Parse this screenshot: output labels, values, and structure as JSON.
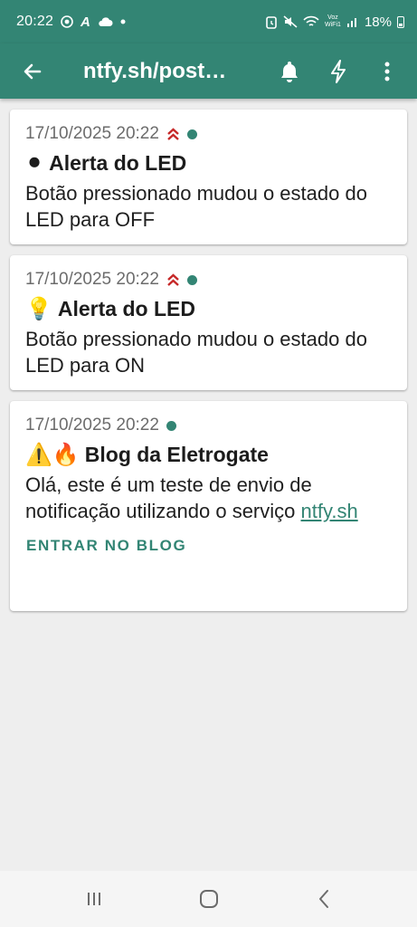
{
  "status_bar": {
    "time": "20:22",
    "battery": "18%",
    "signal_label": "Voz WiFi1",
    "icons": [
      "chrome-icon",
      "a-icon",
      "cloud-icon",
      "dot-icon",
      "alarm-icon",
      "mute-icon",
      "wifi-icon",
      "signal-icon",
      "battery-icon"
    ]
  },
  "app_bar": {
    "title": "ntfy.sh/post…",
    "icons": [
      "back-arrow-icon",
      "bell-icon",
      "lightning-icon",
      "more-vert-icon"
    ]
  },
  "notifications": [
    {
      "timestamp": "17/10/2025 20:22",
      "priority": "high",
      "emoji": "⚫",
      "title": "Alerta do LED",
      "body": "Botão pressionado mudou o estado do LED para OFF"
    },
    {
      "timestamp": "17/10/2025 20:22",
      "priority": "high",
      "emoji": "💡",
      "title": "Alerta do LED",
      "body": "Botão pressionado mudou o estado do LED para ON"
    },
    {
      "timestamp": "17/10/2025 20:22",
      "priority": "default",
      "emoji": "⚠️🔥",
      "title": "Blog da Eletrogate",
      "body_text": "Olá, este é um teste de envio de notificação utilizando o serviço ",
      "body_link": "ntfy.sh",
      "action_label": "ENTRAR NO BLOG"
    }
  ],
  "colors": {
    "accent": "#338574",
    "priority_high": "#c62828",
    "background": "#eeeeee"
  },
  "nav_bar": {
    "icons": [
      "recents-icon",
      "home-icon",
      "back-icon"
    ]
  }
}
